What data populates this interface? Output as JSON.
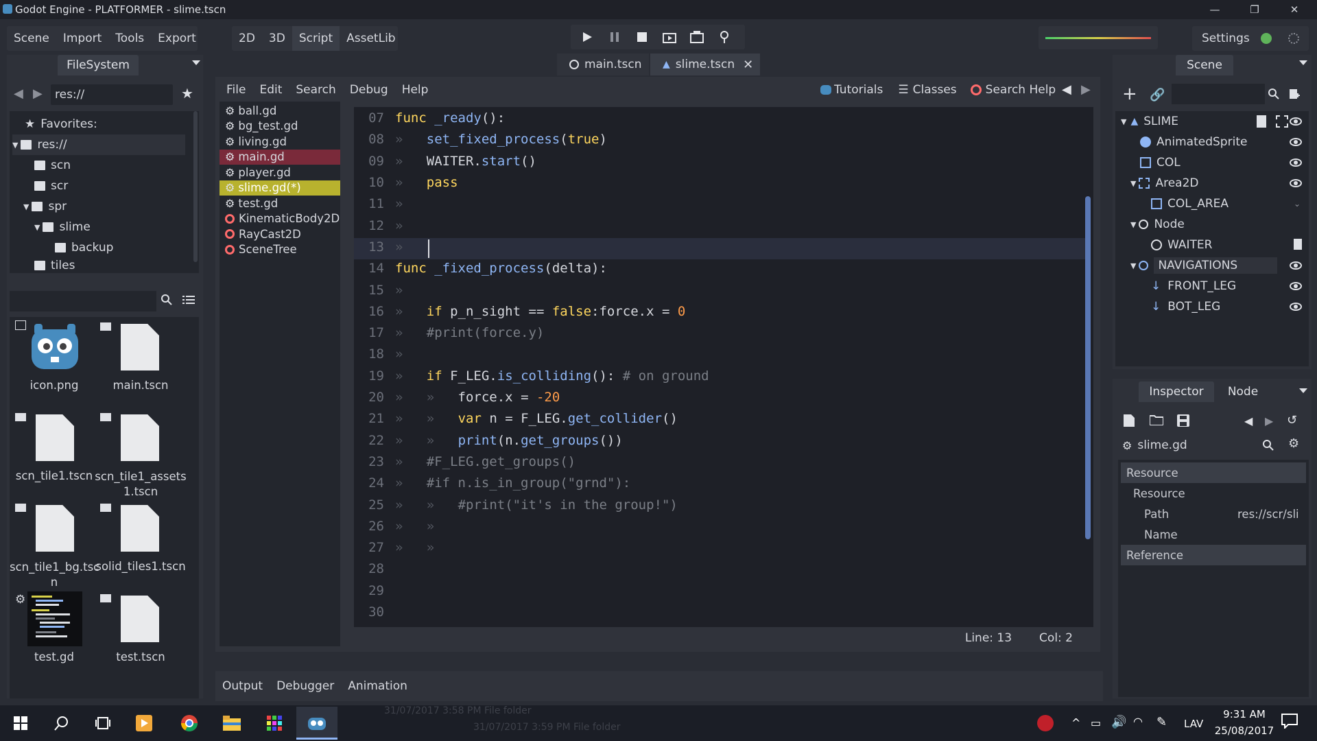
{
  "window": {
    "title": "Godot Engine - PLATFORMER - slime.tscn",
    "minimize": "—",
    "restore": "❐",
    "close": "✕"
  },
  "menus": {
    "scene": "Scene",
    "import": "Import",
    "tools": "Tools",
    "export": "Export"
  },
  "workspaces": {
    "d2": "2D",
    "d3": "3D",
    "script": "Script",
    "assetlib": "AssetLib"
  },
  "settings_label": "Settings",
  "filesystem": {
    "tab": "FileSystem",
    "path": "res://",
    "tree": [
      {
        "label": "Favorites:"
      },
      {
        "label": "res://"
      },
      {
        "label": "scn"
      },
      {
        "label": "scr"
      },
      {
        "label": "spr"
      },
      {
        "label": "slime"
      },
      {
        "label": "backup"
      },
      {
        "label": "tiles"
      }
    ],
    "files": [
      {
        "name": "icon.png"
      },
      {
        "name": "main.tscn"
      },
      {
        "name": "scn_tile1.tscn"
      },
      {
        "name": "scn_tile1_assets\n1.tscn"
      },
      {
        "name": "scn_tile1_bg.tsc\nn"
      },
      {
        "name": "solid_tiles1.tscn"
      },
      {
        "name": "test.gd"
      },
      {
        "name": "test.tscn"
      }
    ]
  },
  "scene_tabs": {
    "main": "main.tscn",
    "slime": "slime.tscn"
  },
  "script_menu": {
    "file": "File",
    "edit": "Edit",
    "search": "Search",
    "debug": "Debug",
    "help": "Help",
    "tutorials": "Tutorials",
    "classes": "Classes",
    "search_help": "Search Help"
  },
  "script_list": [
    {
      "name": "ball.gd",
      "state": "normal"
    },
    {
      "name": "bg_test.gd",
      "state": "normal"
    },
    {
      "name": "living.gd",
      "state": "normal"
    },
    {
      "name": "main.gd",
      "state": "red"
    },
    {
      "name": "player.gd",
      "state": "normal"
    },
    {
      "name": "slime.gd(*)",
      "state": "active"
    },
    {
      "name": "test.gd",
      "state": "normal"
    },
    {
      "name": "KinematicBody2D",
      "state": "doc"
    },
    {
      "name": "RayCast2D",
      "state": "doc"
    },
    {
      "name": "SceneTree",
      "state": "doc"
    }
  ],
  "code": {
    "lines": [
      {
        "n": "07",
        "t": "func _ready():"
      },
      {
        "n": "08",
        "t": "»   set_fixed_process(true)"
      },
      {
        "n": "09",
        "t": "»   WAITER.start()"
      },
      {
        "n": "10",
        "t": "»   pass"
      },
      {
        "n": "11",
        "t": "»"
      },
      {
        "n": "12",
        "t": "»"
      },
      {
        "n": "13",
        "t": "»"
      },
      {
        "n": "14",
        "t": "func _fixed_process(delta):"
      },
      {
        "n": "15",
        "t": "»"
      },
      {
        "n": "16",
        "t": "»   if p_n_sight == false:force.x = 0"
      },
      {
        "n": "17",
        "t": "»   #print(force.y)"
      },
      {
        "n": "18",
        "t": "»"
      },
      {
        "n": "19",
        "t": "»   if F_LEG.is_colliding(): # on ground"
      },
      {
        "n": "20",
        "t": "»   »   force.x = -20"
      },
      {
        "n": "21",
        "t": "»   »   var n = F_LEG.get_collider()"
      },
      {
        "n": "22",
        "t": "»   »   print(n.get_groups())"
      },
      {
        "n": "23",
        "t": "»   #F_LEG.get_groups()"
      },
      {
        "n": "24",
        "t": "»   #if n.is_in_group(\"grnd\"):"
      },
      {
        "n": "25",
        "t": "»   »   #print(\"it's in the group!\")"
      },
      {
        "n": "26",
        "t": "»   »"
      },
      {
        "n": "27",
        "t": "»   »"
      },
      {
        "n": "28",
        "t": ""
      },
      {
        "n": "29",
        "t": ""
      },
      {
        "n": "30",
        "t": ""
      }
    ],
    "status_line": "Line: 13",
    "status_col": "Col: 2"
  },
  "bottom_tabs": {
    "output": "Output",
    "debugger": "Debugger",
    "animation": "Animation"
  },
  "scene_panel": {
    "tab": "Scene",
    "nodes": [
      {
        "label": "SLIME"
      },
      {
        "label": "AnimatedSprite"
      },
      {
        "label": "COL"
      },
      {
        "label": "Area2D"
      },
      {
        "label": "COL_AREA"
      },
      {
        "label": "Node"
      },
      {
        "label": "WAITER"
      },
      {
        "label": "NAVIGATIONS"
      },
      {
        "label": "FRONT_LEG"
      },
      {
        "label": "BOT_LEG"
      }
    ]
  },
  "inspector": {
    "tab_inspector": "Inspector",
    "tab_node": "Node",
    "resource_name": "slime.gd",
    "section_resource": "Resource",
    "sub_resource": "Resource",
    "path_label": "Path",
    "path_value": "res://scr/sli",
    "name_label": "Name",
    "section_reference": "Reference"
  },
  "taskbar": {
    "ghost1": "31/07/2017 3:58 PM     File folder",
    "ghost2": "31/07/2017 3:59 PM     File folder",
    "lang": "LAV",
    "time": "9:31 AM",
    "date": "25/08/2017"
  }
}
